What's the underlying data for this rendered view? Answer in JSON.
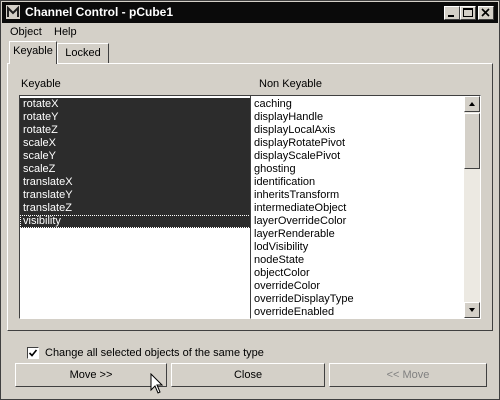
{
  "window": {
    "title": "Channel Control - pCube1",
    "icon": "maya-icon",
    "controls": [
      "minimize-icon",
      "maximize-icon",
      "close-icon"
    ]
  },
  "menubar": {
    "items": [
      {
        "label": "Object"
      },
      {
        "label": "Help"
      }
    ]
  },
  "tabs": [
    {
      "label": "Keyable",
      "active": true
    },
    {
      "label": "Locked",
      "active": false
    }
  ],
  "keyable": {
    "label": "Keyable",
    "items": [
      {
        "label": "rotateX",
        "selected": true
      },
      {
        "label": "rotateY",
        "selected": true
      },
      {
        "label": "rotateZ",
        "selected": true
      },
      {
        "label": "scaleX",
        "selected": true
      },
      {
        "label": "scaleY",
        "selected": true
      },
      {
        "label": "scaleZ",
        "selected": true
      },
      {
        "label": "translateX",
        "selected": true
      },
      {
        "label": "translateY",
        "selected": true
      },
      {
        "label": "translateZ",
        "selected": true
      },
      {
        "label": "visibility",
        "selected": true
      }
    ]
  },
  "non_keyable": {
    "label": "Non Keyable",
    "items": [
      {
        "label": "caching"
      },
      {
        "label": "displayHandle"
      },
      {
        "label": "displayLocalAxis"
      },
      {
        "label": "displayRotatePivot"
      },
      {
        "label": "displayScalePivot"
      },
      {
        "label": "ghosting"
      },
      {
        "label": "identification"
      },
      {
        "label": "inheritsTransform"
      },
      {
        "label": "intermediateObject"
      },
      {
        "label": "layerOverrideColor"
      },
      {
        "label": "layerRenderable"
      },
      {
        "label": "lodVisibility"
      },
      {
        "label": "nodeState"
      },
      {
        "label": "objectColor"
      },
      {
        "label": "overrideColor"
      },
      {
        "label": "overrideDisplayType"
      },
      {
        "label": "overrideEnabled"
      }
    ]
  },
  "options": {
    "change_all_label": "Change all selected objects of the same type",
    "change_all_checked": true
  },
  "buttons": {
    "move_right": "Move >>",
    "close": "Close",
    "move_left": "<< Move"
  }
}
